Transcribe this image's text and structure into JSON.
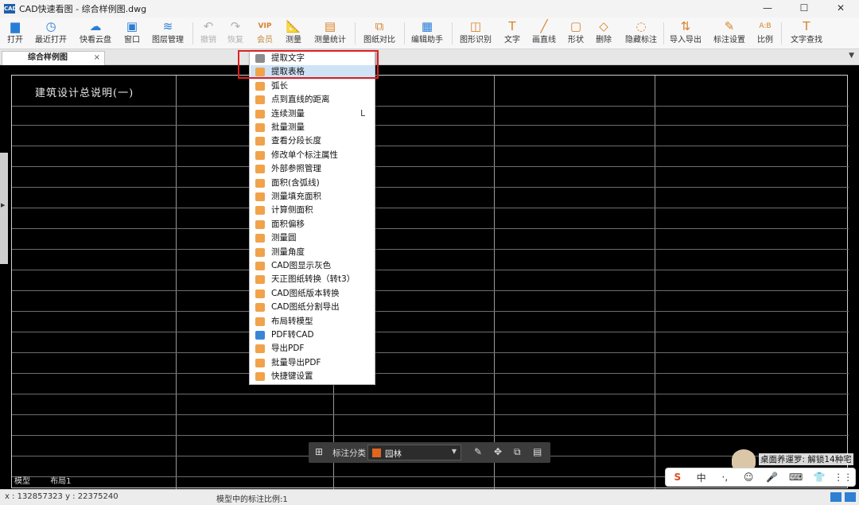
{
  "window": {
    "logo": "CAD",
    "title": "CAD快速看图 - 综合样例图.dwg",
    "controls": [
      "—",
      "☐",
      "✕"
    ]
  },
  "toolbar": {
    "open": "打开",
    "recent": "最近打开",
    "cloud": "快看云盘",
    "window": "窗口",
    "layers": "图层管理",
    "undo": "撤销",
    "redo": "恢复",
    "vip": "会员",
    "measure": "测量",
    "measure_stats": "测量统计",
    "compare": "图纸对比",
    "edit_assistant": "编辑助手",
    "shape_recog": "图形识别",
    "text": "文字",
    "line": "画直线",
    "shape": "形状",
    "delete": "删除",
    "hide_annot": "隐藏标注",
    "import_export": "导入导出",
    "annot_settings": "标注设置",
    "scale": "比例",
    "text_search": "文字查找",
    "vip_badge": "VIP"
  },
  "tabs": {
    "doc_tab": "综合样例图",
    "close": "×"
  },
  "drawing": {
    "title": "建筑设计总说明(一)"
  },
  "menu": {
    "items": [
      {
        "label": "提取文字",
        "icon": "text-extract-icon"
      },
      {
        "label": "提取表格",
        "icon": "table-extract-icon"
      },
      {
        "label": "弧长",
        "icon": "arc-length-icon"
      },
      {
        "label": "点到直线的距离",
        "icon": "point-line-distance-icon"
      },
      {
        "label": "连续测量",
        "icon": "continuous-measure-icon",
        "key": "L"
      },
      {
        "label": "批量测量",
        "icon": "batch-measure-icon"
      },
      {
        "label": "查看分段长度",
        "icon": "segment-length-icon"
      },
      {
        "label": "修改单个标注属性",
        "icon": "edit-annotation-icon"
      },
      {
        "label": "外部参照管理",
        "icon": "xref-icon"
      },
      {
        "label": "面积(含弧线)",
        "icon": "area-arc-icon"
      },
      {
        "label": "测量填充面积",
        "icon": "fill-area-icon"
      },
      {
        "label": "计算侧面积",
        "icon": "side-area-icon"
      },
      {
        "label": "面积偏移",
        "icon": "area-offset-icon"
      },
      {
        "label": "测量圆",
        "icon": "circle-measure-icon"
      },
      {
        "label": "测量角度",
        "icon": "angle-measure-icon"
      },
      {
        "label": "CAD图显示灰色",
        "icon": "gray-display-icon"
      },
      {
        "label": "天正图纸转换（转t3）",
        "icon": "tangent-convert-icon"
      },
      {
        "label": "CAD图纸版本转换",
        "icon": "version-convert-icon"
      },
      {
        "label": "CAD图纸分割导出",
        "icon": "split-export-icon"
      },
      {
        "label": "布局转模型",
        "icon": "layout-to-model-icon"
      },
      {
        "label": "PDF转CAD",
        "icon": "pdf-to-cad-icon"
      },
      {
        "label": "导出PDF",
        "icon": "export-pdf-icon"
      },
      {
        "label": "批量导出PDF",
        "icon": "batch-export-pdf-icon"
      },
      {
        "label": "快捷键设置",
        "icon": "shortcut-icon"
      }
    ]
  },
  "annotation_bar": {
    "label": "标注分类",
    "value": "园林",
    "swatch_color": "#e0651f"
  },
  "layout_tabs": [
    "模型",
    "布局1"
  ],
  "status": {
    "coords": "x : 132857323   y : 22375240",
    "scale_text": "模型中的标注比例:1"
  },
  "notification": {
    "text": "桌面养運罗: 解锁14种宅"
  },
  "ime": [
    "S",
    "中",
    "·,",
    "☺",
    "🎤",
    "⌨",
    "👕",
    "⋮⋮"
  ]
}
